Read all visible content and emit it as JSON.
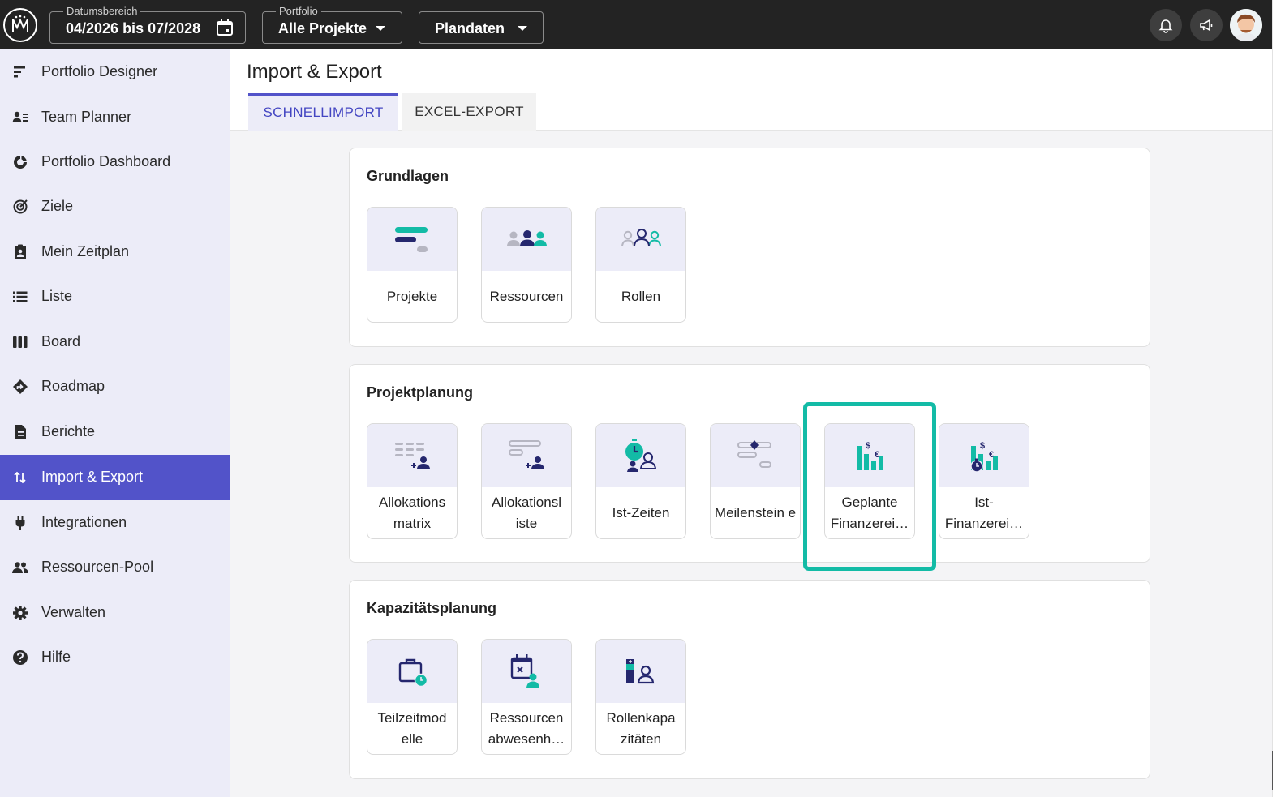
{
  "topbar": {
    "date_range": {
      "legend": "Datumsbereich",
      "value": "04/2026 bis 07/2028"
    },
    "portfolio": {
      "legend": "Portfolio",
      "value": "Alle Projekte"
    },
    "data_mode": {
      "value": "Plandaten"
    }
  },
  "sidebar": {
    "items": [
      {
        "label": "Portfolio Designer",
        "icon": "portfolio-designer-icon"
      },
      {
        "label": "Team Planner",
        "icon": "team-planner-icon"
      },
      {
        "label": "Portfolio Dashboard",
        "icon": "dashboard-icon"
      },
      {
        "label": "Ziele",
        "icon": "target-icon"
      },
      {
        "label": "Mein Zeitplan",
        "icon": "schedule-icon"
      },
      {
        "label": "Liste",
        "icon": "list-icon"
      },
      {
        "label": "Board",
        "icon": "board-icon"
      },
      {
        "label": "Roadmap",
        "icon": "roadmap-icon"
      },
      {
        "label": "Berichte",
        "icon": "report-icon"
      },
      {
        "label": "Import & Export",
        "icon": "import-export-icon",
        "active": true
      },
      {
        "label": "Integrationen",
        "icon": "plug-icon"
      },
      {
        "label": "Ressourcen-Pool",
        "icon": "people-icon"
      },
      {
        "label": "Verwalten",
        "icon": "gear-icon"
      },
      {
        "label": "Hilfe",
        "icon": "help-icon"
      }
    ]
  },
  "main": {
    "title": "Import & Export",
    "tabs": [
      {
        "label": "SCHNELLIMPORT",
        "active": true
      },
      {
        "label": "EXCEL-EXPORT",
        "active": false
      }
    ],
    "sections": [
      {
        "title": "Grundlagen",
        "tiles": [
          {
            "label": "Projekte",
            "icon": "projects-icon"
          },
          {
            "label": "Ressourcen",
            "icon": "resources-icon"
          },
          {
            "label": "Rollen",
            "icon": "roles-icon"
          }
        ]
      },
      {
        "title": "Projektplanung",
        "tiles": [
          {
            "label": "Allokations matrix",
            "icon": "allocation-matrix-icon"
          },
          {
            "label": "Allokationsl iste",
            "icon": "allocation-list-icon"
          },
          {
            "label": "Ist-Zeiten",
            "icon": "actual-times-icon"
          },
          {
            "label": "Meilenstein e",
            "icon": "milestones-icon"
          },
          {
            "label": "Geplante Finanzerei…",
            "icon": "planned-finance-icon",
            "highlighted": true
          },
          {
            "label": "Ist-Finanzerei…",
            "icon": "actual-finance-icon"
          }
        ]
      },
      {
        "title": "Kapazitätsplanung",
        "tiles": [
          {
            "label": "Teilzeitmod elle",
            "icon": "part-time-icon"
          },
          {
            "label": "Ressourcen abwesenh…",
            "icon": "absence-icon"
          },
          {
            "label": "Rollenkapa zitäten",
            "icon": "role-capacity-icon"
          }
        ]
      }
    ]
  },
  "colors": {
    "topbar": "#232323",
    "sidebar": "#ececf8",
    "active": "#5253c9",
    "teal": "#13bba6",
    "navy": "#25276e"
  }
}
